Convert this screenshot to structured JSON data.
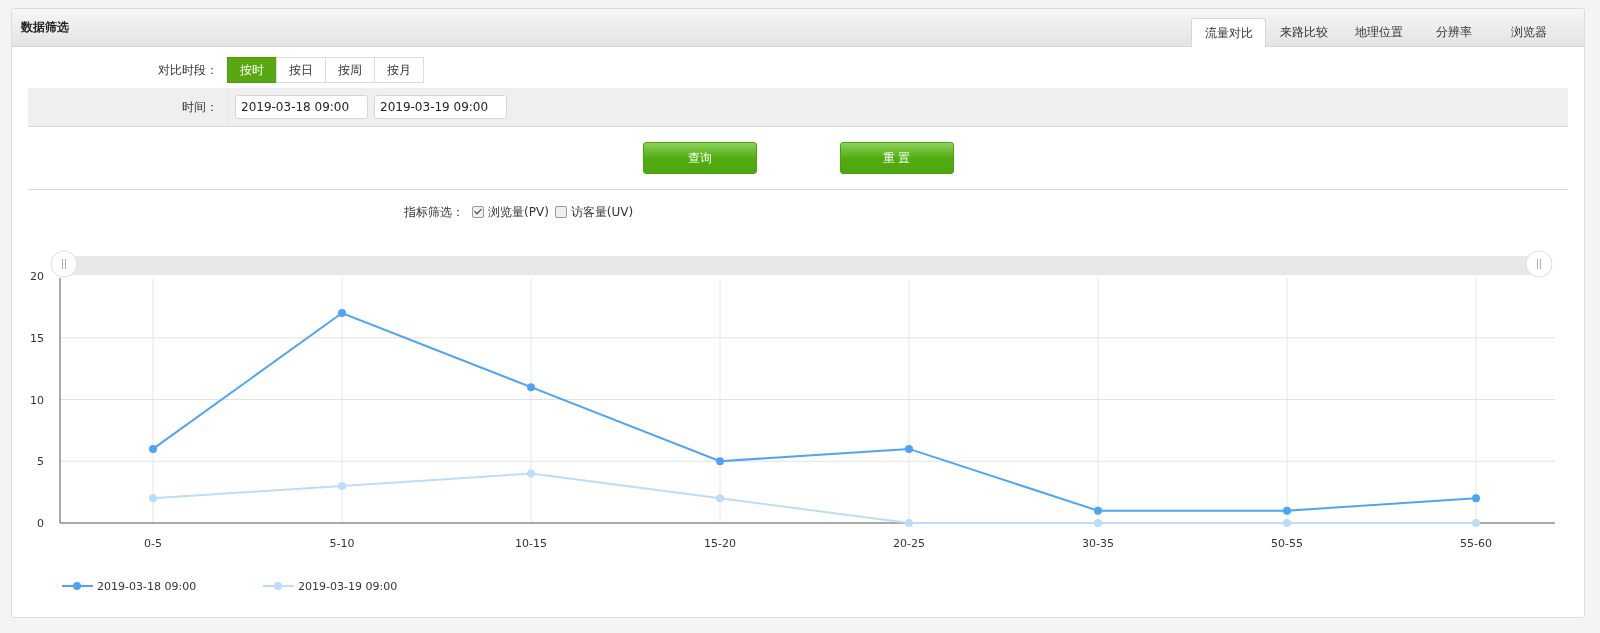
{
  "panel": {
    "title": "数据筛选"
  },
  "tabs": [
    {
      "label": "流量对比",
      "selected": true
    },
    {
      "label": "来路比较",
      "selected": false
    },
    {
      "label": "地理位置",
      "selected": false
    },
    {
      "label": "分辨率",
      "selected": false
    },
    {
      "label": "浏览器",
      "selected": false
    }
  ],
  "period": {
    "label": "对比时段：",
    "options": [
      {
        "label": "按时",
        "selected": true
      },
      {
        "label": "按日",
        "selected": false
      },
      {
        "label": "按周",
        "selected": false
      },
      {
        "label": "按月",
        "selected": false
      }
    ]
  },
  "time": {
    "label": "时间：",
    "start": "2019-03-18 09:00",
    "end": "2019-03-19 09:00"
  },
  "buttons": [
    "查询",
    "重 置"
  ],
  "metrics": {
    "label": "指标筛选：",
    "items": [
      {
        "label": "浏览量(PV)",
        "checked": true
      },
      {
        "label": "访客量(UV)",
        "checked": false
      }
    ]
  },
  "chart_data": {
    "type": "line",
    "grid": true,
    "legend": true,
    "categories": [
      "0-5",
      "5-10",
      "10-15",
      "15-20",
      "20-25",
      "30-35",
      "50-55",
      "55-60"
    ],
    "ylim": [
      0,
      20
    ],
    "yticks": [
      0,
      5,
      10,
      15,
      20
    ],
    "series": [
      {
        "name": "2019-03-18 09:00",
        "color": "#4da3f5",
        "marker": "circle",
        "values": [
          6,
          17,
          11,
          5,
          6,
          1,
          1,
          2
        ]
      },
      {
        "name": "2019-03-19 09:00",
        "color": "#bcdcf8",
        "marker": "circle",
        "values": [
          2,
          3,
          4,
          2,
          0,
          0,
          0,
          0
        ]
      }
    ]
  }
}
